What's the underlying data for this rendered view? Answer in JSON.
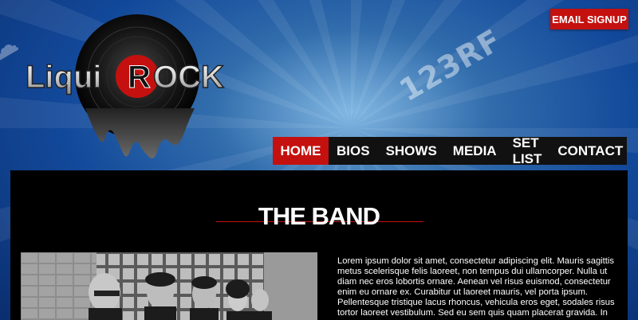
{
  "header": {
    "email_signup_label": "EMAIL SIGNUP",
    "logo_text_left": "Liqui",
    "logo_text_mid": "R",
    "logo_text_right": "OCK"
  },
  "watermark": {
    "text": "123RF"
  },
  "nav": {
    "items": [
      {
        "label": "HOME",
        "active": true
      },
      {
        "label": "BIOS",
        "active": false
      },
      {
        "label": "SHOWS",
        "active": false
      },
      {
        "label": "MEDIA",
        "active": false
      },
      {
        "label": "SET LIST",
        "active": false
      },
      {
        "label": "CONTACT",
        "active": false
      }
    ]
  },
  "main": {
    "title": "THE BAND",
    "body": "Lorem ipsum dolor sit amet, consectetur adipiscing elit. Mauris sagittis metus scelerisque felis laoreet, non tempus dui ullamcorper. Nulla ut diam nec eros lobortis ornare. Aenean vel risus euismod, consectetur enim eu ornare ex. Curabitur ut laoreet mauris, vel porta ipsum. Pellentesque tristique lacus rhoncus, vehicula eros eget, sodales risus tortor laoreet vestibulum. Sed eu sem quis quam placerat gravida. In"
  },
  "colors": {
    "accent": "#c4110f",
    "nav_bg": "#111111",
    "content_bg": "#000000",
    "sky": "#4a9be6"
  }
}
